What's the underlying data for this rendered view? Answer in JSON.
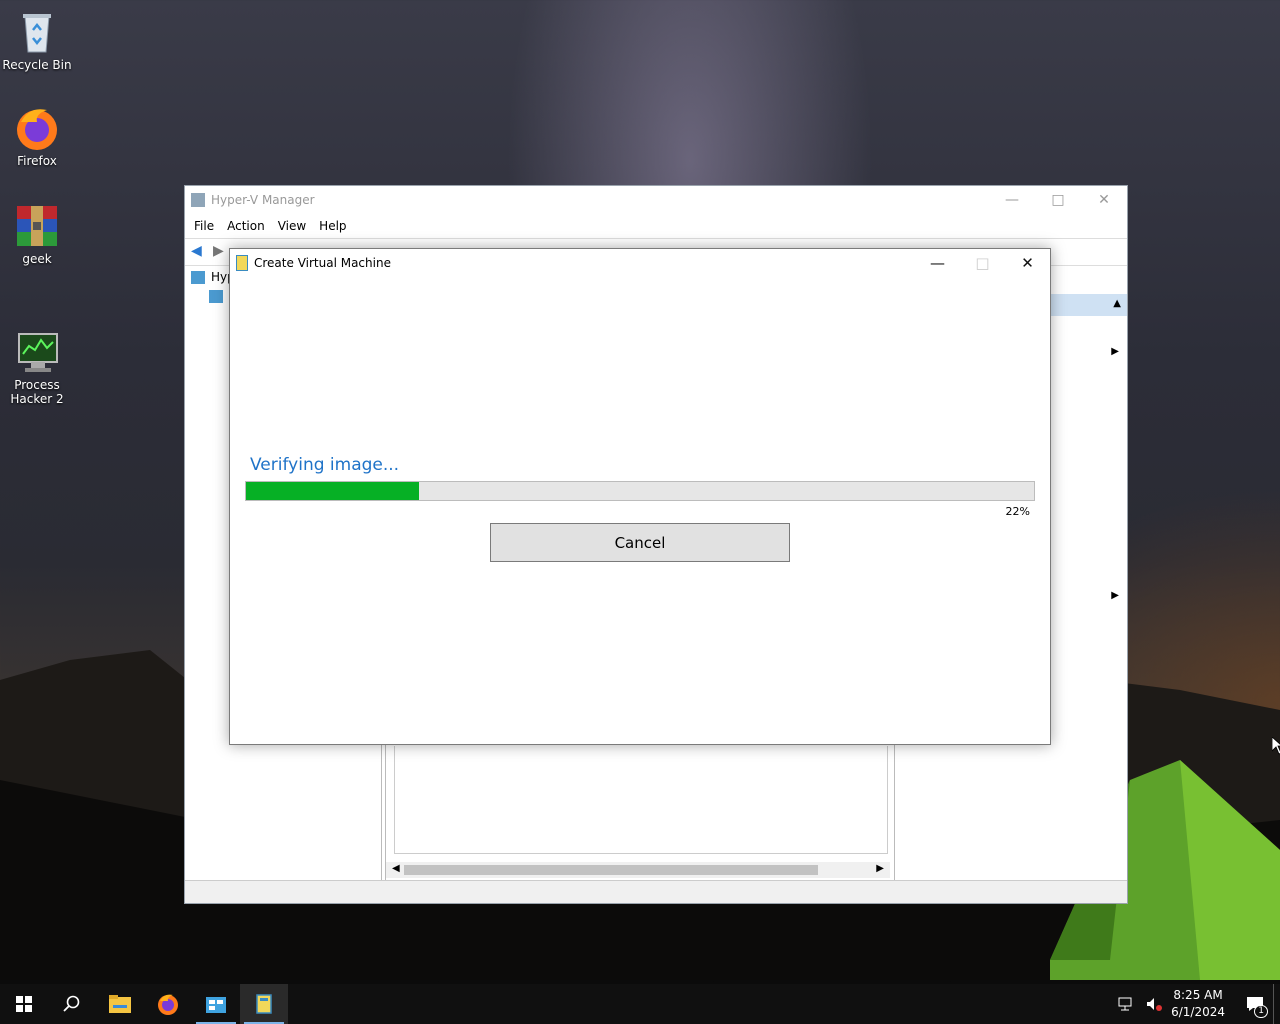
{
  "desktop": {
    "icons": [
      {
        "label": "Recycle Bin",
        "icon": "recycle-bin-icon"
      },
      {
        "label": "Firefox",
        "icon": "firefox-icon"
      },
      {
        "label": "geek",
        "icon": "winrar-icon"
      },
      {
        "label": "Process\nHacker 2",
        "icon": "process-hacker-icon"
      }
    ]
  },
  "hyperv_window": {
    "title": "Hyper-V Manager",
    "menu": [
      "File",
      "Action",
      "View",
      "Help"
    ],
    "tree_root_partial": "Hyp"
  },
  "dialog": {
    "title": "Create Virtual Machine",
    "status_text": "Verifying image...",
    "progress_percent": 22,
    "progress_label": "22%",
    "cancel_label": "Cancel",
    "progress_color": "#06b025",
    "status_color": "#1f73c8"
  },
  "taskbar": {
    "items": [
      "start-icon",
      "search-icon",
      "file-explorer-icon",
      "firefox-icon",
      "hyperv-manager-icon",
      "create-vm-icon"
    ],
    "time": "8:25 AM",
    "date": "6/1/2024",
    "notification_count": "1"
  }
}
